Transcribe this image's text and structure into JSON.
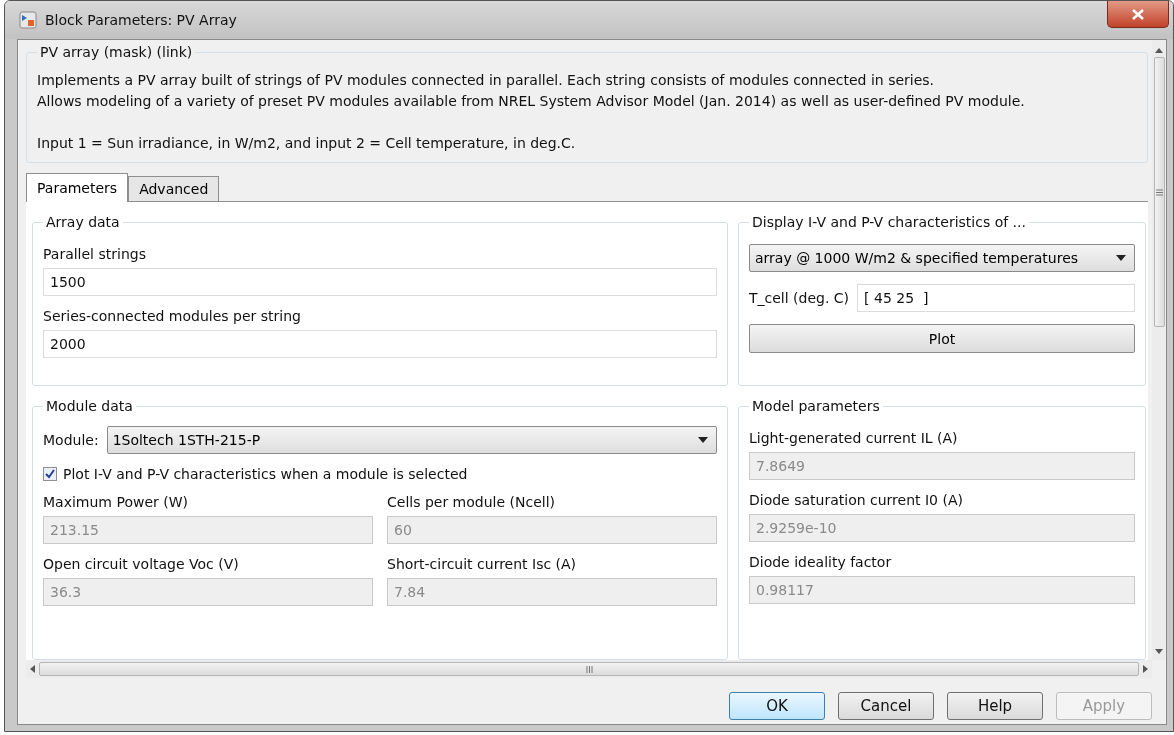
{
  "window": {
    "title": "Block Parameters: PV Array"
  },
  "description": {
    "title": "PV array (mask) (link)",
    "lines": [
      "Implements a PV array built of strings of PV modules connected in parallel. Each string consists of modules connected in series.",
      "Allows modeling of a variety of preset PV modules available from NREL System Advisor Model (Jan. 2014) as well as user-defined PV module.",
      "Input 1 = Sun irradiance, in W/m2, and input 2 = Cell temperature, in deg.C."
    ]
  },
  "tabs": [
    {
      "label": "Parameters",
      "selected": true
    },
    {
      "label": "Advanced",
      "selected": false
    }
  ],
  "array_data": {
    "title": "Array data",
    "fields": [
      {
        "label": "Parallel strings",
        "value": "1500",
        "disabled": false
      },
      {
        "label": "Series-connected modules per string",
        "value": "2000",
        "disabled": false
      }
    ]
  },
  "display": {
    "title": "Display  I-V and P-V characteristics of ...",
    "dropdown": "array @ 1000 W/m2 & specified temperatures",
    "t_cell": {
      "label": "T_cell (deg. C)",
      "value": "[ 45 25  ]"
    },
    "plot_button": "Plot"
  },
  "module_data": {
    "title": "Module data",
    "module": {
      "label": "Module:",
      "value": "1Soltech 1STH-215-P"
    },
    "plot_checkbox": {
      "label": "Plot I-V and P-V characteristics when a module is selected",
      "checked": true
    },
    "fields": [
      {
        "label": "Maximum Power (W)",
        "value": "213.15",
        "disabled": true
      },
      {
        "label": "Cells per module (Ncell)",
        "value": "60",
        "disabled": true
      },
      {
        "label": "Open circuit voltage  Voc (V)",
        "value": "36.3",
        "disabled": true
      },
      {
        "label": "Short-circuit current Isc (A)",
        "value": "7.84",
        "disabled": true
      }
    ]
  },
  "model_parameters": {
    "title": "Model parameters",
    "fields": [
      {
        "label": "Light-generated current IL (A)",
        "value": "7.8649",
        "disabled": true
      },
      {
        "label": "Diode saturation current I0 (A)",
        "value": "2.9259e-10",
        "disabled": true
      },
      {
        "label": "Diode ideality factor",
        "value": "0.98117",
        "disabled": true
      }
    ]
  },
  "buttons": [
    {
      "label": "OK",
      "kind": "default",
      "disabled": false
    },
    {
      "label": "Cancel",
      "kind": "normal",
      "disabled": false
    },
    {
      "label": "Help",
      "kind": "normal",
      "disabled": false
    },
    {
      "label": "Apply",
      "kind": "normal",
      "disabled": true
    }
  ]
}
